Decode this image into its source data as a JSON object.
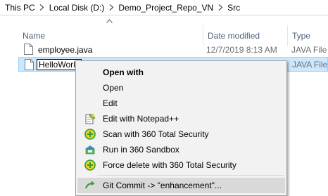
{
  "breadcrumb": [
    "This PC",
    "Local Disk (D:)",
    "Demo_Project_Repo_VN",
    "Src"
  ],
  "columns": {
    "name": "Name",
    "date": "Date modified",
    "type": "Type"
  },
  "files": [
    {
      "name": "employee.java",
      "date": "12/7/2019 8:13 AM",
      "type": "JAVA File"
    },
    {
      "name": "HelloWorld",
      "date": "",
      "type": "JAVA File"
    }
  ],
  "context_menu": {
    "items": [
      {
        "label": "Open with",
        "bold": true,
        "icon": ""
      },
      {
        "label": "Open",
        "icon": ""
      },
      {
        "label": "Edit",
        "icon": ""
      },
      {
        "label": "Edit with Notepad++",
        "icon": "notepad-plus-plus-icon"
      },
      {
        "label": "Scan with 360 Total Security",
        "icon": "360-security-icon"
      },
      {
        "label": "Run in 360 Sandbox",
        "icon": "sandbox-icon"
      },
      {
        "label": "Force delete with 360 Total Security",
        "icon": "360-security-icon"
      },
      {
        "label": "Git Commit -> \"enhancement\"...",
        "icon": "git-commit-icon"
      }
    ]
  },
  "colors": {
    "selection": "#cce8ff",
    "selection_border": "#99d1ff",
    "header_text": "#4c607a",
    "menu_bg": "#f2f2f2"
  }
}
